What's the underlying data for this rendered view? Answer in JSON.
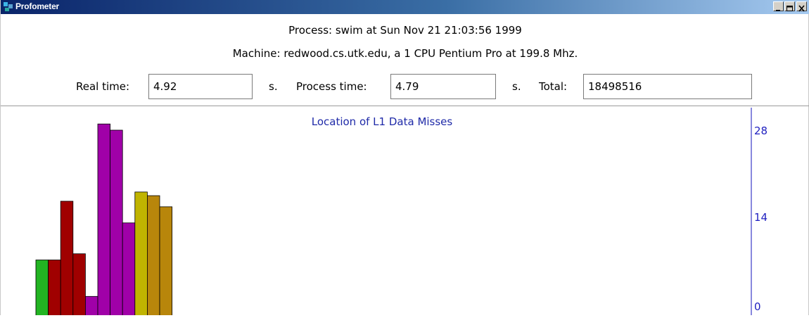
{
  "window": {
    "title": "Profometer"
  },
  "header": {
    "process_line": "Process: swim at Sun Nov 21 21:03:56 1999",
    "machine_line": "Machine: redwood.cs.utk.edu, a 1 CPU Pentium Pro at 199.8 Mhz."
  },
  "fields": {
    "real_time_label": "Real time:",
    "real_time_value": "4.92",
    "real_time_unit": "s.",
    "process_time_label": "Process time:",
    "process_time_value": "4.79",
    "process_time_unit": "s.",
    "total_label": "Total:",
    "total_value": "18498516"
  },
  "icons": {
    "app": "profometer-app-icon",
    "minimize": "minimize-icon",
    "maximize": "maximize-icon",
    "close": "close-icon"
  },
  "colors": {
    "title_gradient_start": "#0a246a",
    "title_gradient_end": "#a6caf0",
    "chart_title": "#1f2aa8",
    "axis": "#3a3ac8"
  },
  "chart_data": {
    "type": "bar",
    "title": "Location of L1 Data Misses",
    "ylim": [
      0,
      28
    ],
    "yticks": [
      0,
      14,
      28
    ],
    "axis_side": "right",
    "series": [
      {
        "values": [
          7.0,
          7.0,
          16.5,
          8.0,
          1.1,
          29.0,
          28.0,
          13.0,
          18.0,
          17.4,
          15.6
        ]
      }
    ],
    "bar_colors": [
      "#22b422",
      "#a00000",
      "#a00000",
      "#a00000",
      "#a000a8",
      "#a000a8",
      "#a000a8",
      "#a000a8",
      "#c0b400",
      "#b8860b",
      "#b8860b"
    ]
  }
}
